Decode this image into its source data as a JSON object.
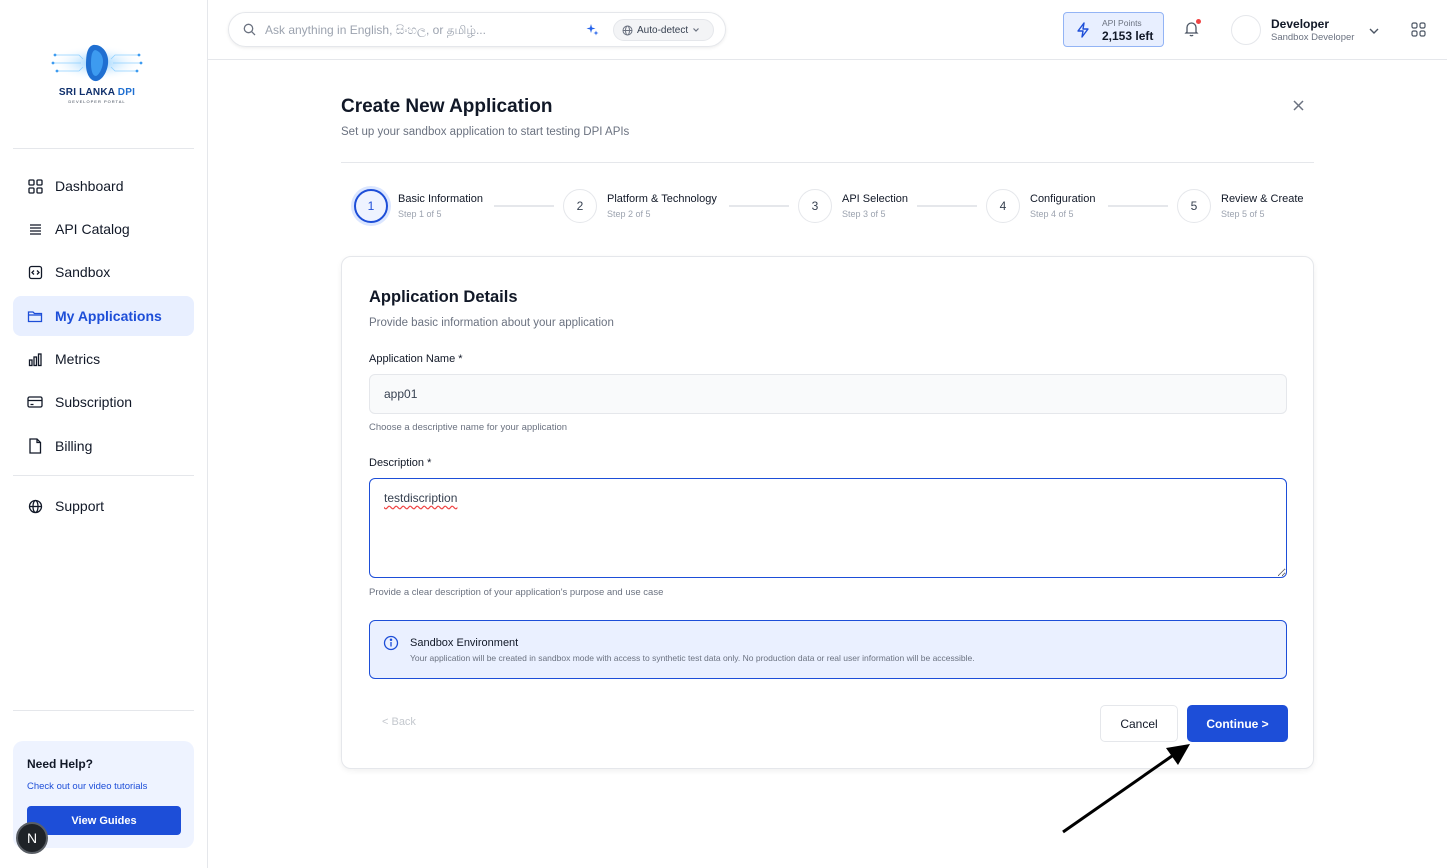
{
  "sidebar": {
    "logo": {
      "title_main": "SRI LANKA ",
      "title_accent": "DPI",
      "subtitle": "DEVELOPER PORTAL"
    },
    "items": [
      {
        "label": "Dashboard",
        "icon": "dashboard-grid-icon"
      },
      {
        "label": "API Catalog",
        "icon": "stack-icon"
      },
      {
        "label": "Sandbox",
        "icon": "code-box-icon"
      },
      {
        "label": "My Applications",
        "icon": "folder-icon",
        "active": true
      },
      {
        "label": "Metrics",
        "icon": "bar-chart-icon"
      },
      {
        "label": "Subscription",
        "icon": "credit-card-icon"
      },
      {
        "label": "Billing",
        "icon": "document-icon"
      },
      {
        "label": "Support",
        "icon": "globe-icon"
      }
    ],
    "help": {
      "title": "Need Help?",
      "subtitle": "Check out our video tutorials",
      "button": "View Guides"
    },
    "badge": "N"
  },
  "header": {
    "search_placeholder": "Ask anything in English, සිංහල, or தமிழ்...",
    "language": "Auto-detect",
    "points_label": "API Points",
    "points_value": "2,153 left",
    "user_name": "Developer",
    "user_role": "Sandbox Developer"
  },
  "page": {
    "title": "Create New Application",
    "subtitle": "Set up your sandbox application to start testing DPI APIs"
  },
  "steps": [
    {
      "number": "1",
      "title": "Basic Information",
      "sub": "Step 1 of 5",
      "active": true
    },
    {
      "number": "2",
      "title": "Platform & Technology",
      "sub": "Step 2 of 5"
    },
    {
      "number": "3",
      "title": "API Selection",
      "sub": "Step 3 of 5"
    },
    {
      "number": "4",
      "title": "Configuration",
      "sub": "Step 4 of 5"
    },
    {
      "number": "5",
      "title": "Review & Create",
      "sub": "Step 5 of 5"
    }
  ],
  "form": {
    "title": "Application Details",
    "subtitle": "Provide basic information about your application",
    "name_label": "Application Name *",
    "name_value": "app01",
    "name_help": "Choose a descriptive name for your application",
    "desc_label": "Description *",
    "desc_value": "testdiscription",
    "desc_help": "Provide a clear description of your application's purpose and use case",
    "sandbox_title": "Sandbox Environment",
    "sandbox_text": "Your application will be created in sandbox mode with access to synthetic test data only. No production data or real user information will be accessible.",
    "back": "< Back",
    "cancel": "Cancel",
    "continue": "Continue >"
  },
  "colors": {
    "primary": "#1d4ed8",
    "active_bg": "#e8efff",
    "notification": "#ef4444"
  }
}
